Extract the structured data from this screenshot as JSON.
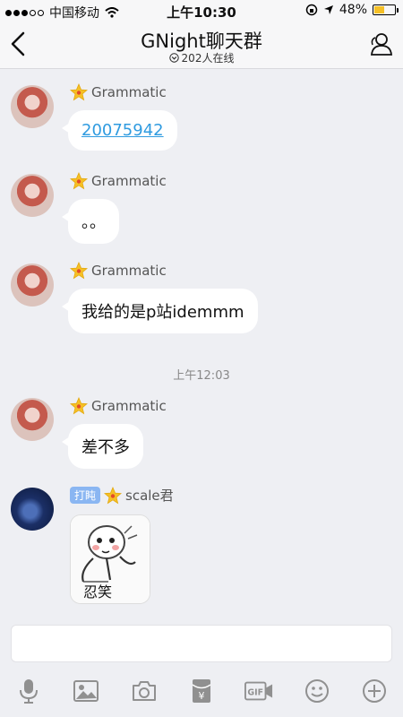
{
  "status_bar": {
    "carrier": "中国移动",
    "time": "上午10:30",
    "battery": "48%",
    "battery_level": 0.48
  },
  "header": {
    "title": "GNight聊天群",
    "online": "202人在线"
  },
  "messages": [
    {
      "sender": "Grammatic",
      "text": "20075942",
      "is_link": true
    },
    {
      "sender": "Grammatic",
      "text": "。。"
    },
    {
      "sender": "Grammatic",
      "text": "我给的是p站idemmm"
    },
    {
      "sender": "Grammatic",
      "text": "差不多"
    },
    {
      "sender": "scale君",
      "tag": "打盹",
      "sticker_caption": "忍笑"
    }
  ],
  "timestamp": "上午12:03",
  "input": {
    "placeholder": ""
  },
  "toolbar_icons": [
    "microphone-icon",
    "image-icon",
    "camera-icon",
    "red-packet-icon",
    "gif-icon",
    "emoji-icon",
    "plus-icon"
  ],
  "colors": {
    "accent": "#f6c026",
    "link": "#2f9be0",
    "tag": "#8ab6f2",
    "background": "#eeeff3"
  }
}
